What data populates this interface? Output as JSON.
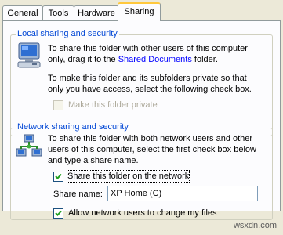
{
  "tabs": [
    {
      "label": "General"
    },
    {
      "label": "Tools"
    },
    {
      "label": "Hardware"
    },
    {
      "label": "Sharing"
    }
  ],
  "local": {
    "legend": "Local sharing and security",
    "p1_a": "To share this folder with other users of this computer",
    "p1_b": "only, drag it to the ",
    "p1_link": "Shared Documents",
    "p1_c": " folder.",
    "p2_a": "To make this folder and its subfolders private so that",
    "p2_b": "only you have access, select the following check box.",
    "private_label": "Make this folder private",
    "private_checked": false,
    "private_enabled": false
  },
  "network": {
    "legend": "Network sharing and security",
    "p1_a": "To share this folder with both network users and other",
    "p1_b": "users of this computer, select the first check box below",
    "p1_c": "and type a share name.",
    "share_label": "Share this folder on the network",
    "share_checked": true,
    "share_name_label": "Share name:",
    "share_name_value": "XP Home (C)",
    "allow_label": "Allow network users to change my files",
    "allow_checked": true
  },
  "watermark": "wsxdn.com"
}
